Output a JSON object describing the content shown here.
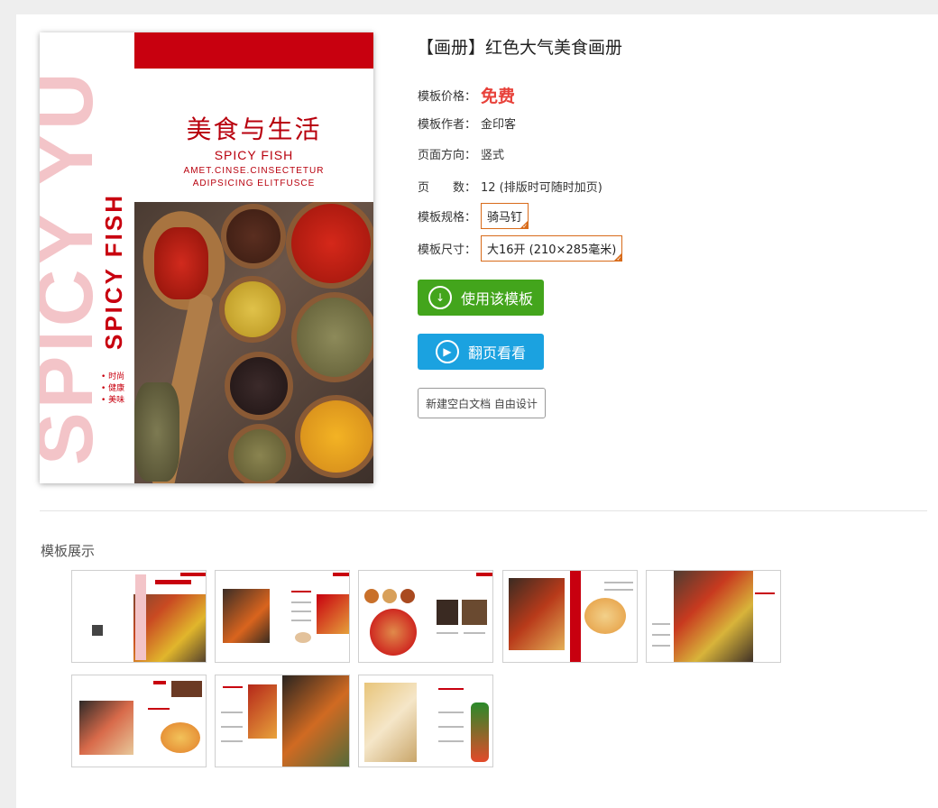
{
  "cover": {
    "vertical_text": "SPICY YU",
    "spicy_fish": "SPICY FISH",
    "title": "美食与生活",
    "subtitle": "SPICY FISH",
    "tagline_1": "AMET.CINSE.CINSECTETUR",
    "tagline_2": "ADIPSICING ELITFUSCE",
    "bullets": [
      "• 时尚",
      "• 健康",
      "• 美味"
    ]
  },
  "info": {
    "title": "【画册】红色大气美食画册",
    "price_label": "模板价格：",
    "price_value": "免费",
    "author_label": "模板作者：",
    "author_value": "金印客",
    "orientation_label": "页面方向：",
    "orientation_value": "竖式",
    "pages_label": "页　　数：",
    "pages_value": "12 (排版时可随时加页)",
    "spec_label": "模板规格：",
    "spec_value": "骑马钉",
    "size_label": "模板尺寸：",
    "size_value": "大16开 (210×285毫米)"
  },
  "buttons": {
    "use": "使用该模板",
    "flip": "翻页看看",
    "blank": "新建空白文档 自由设计"
  },
  "gallery": {
    "title": "模板展示"
  },
  "colors": {
    "brand_red": "#c8000f",
    "price_red": "#e8413a",
    "use_green": "#43a51c",
    "flip_blue": "#1ba2e0",
    "option_orange": "#d86b1a"
  }
}
